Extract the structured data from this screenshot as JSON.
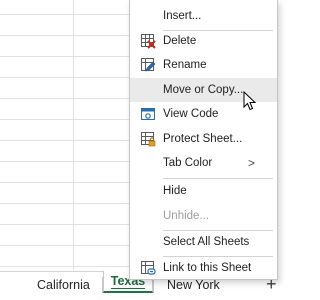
{
  "sheet_tabs": {
    "california": "California",
    "texas": "Texas",
    "new_york": "New York",
    "add_icon_glyph": "+"
  },
  "context_menu": {
    "items": [
      {
        "label": "Insert...",
        "icon": "none"
      },
      {
        "label": "Delete",
        "icon": "delete-sheet-icon"
      },
      {
        "label": "Rename",
        "icon": "rename-icon"
      },
      {
        "label": "Move or Copy...",
        "icon": "none",
        "hovered": true
      },
      {
        "label": "View Code",
        "icon": "view-code-icon"
      },
      {
        "label": "Protect Sheet...",
        "icon": "protect-sheet-icon"
      },
      {
        "label": "Tab Color",
        "icon": "none",
        "submenu": true,
        "submenu_arrow": ">"
      },
      {
        "label": "Hide",
        "icon": "none"
      },
      {
        "label": "Unhide...",
        "icon": "none",
        "disabled": true
      },
      {
        "label": "Select All Sheets",
        "icon": "none"
      },
      {
        "label": "Link to this Sheet",
        "icon": "link-sheet-icon"
      }
    ]
  },
  "colors": {
    "accent_green": "#217346",
    "hover_bg": "#eaeaea",
    "disabled_text": "#9d9d9d"
  }
}
